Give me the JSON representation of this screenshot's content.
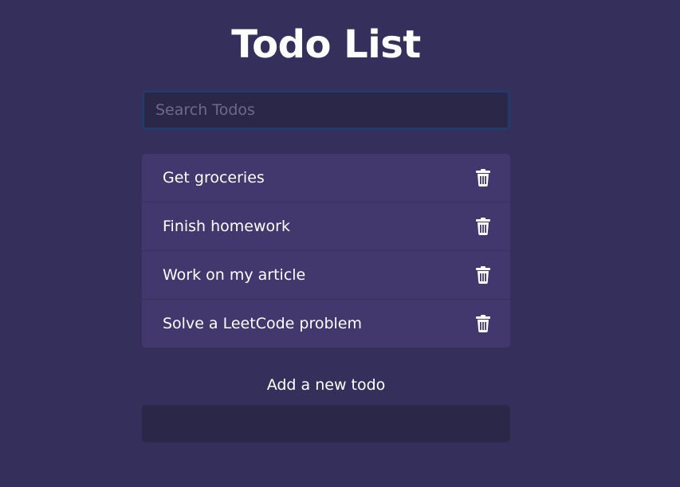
{
  "header": {
    "title": "Todo List"
  },
  "search": {
    "placeholder": "Search Todos",
    "value": ""
  },
  "todos": [
    {
      "label": "Get groceries",
      "icon": "trash-icon"
    },
    {
      "label": "Finish homework",
      "icon": "trash-icon"
    },
    {
      "label": "Work on my article",
      "icon": "trash-icon"
    },
    {
      "label": "Solve a LeetCode problem",
      "icon": "trash-icon"
    }
  ],
  "add_form": {
    "label": "Add a new todo",
    "value": ""
  },
  "colors": {
    "background": "#352f5b",
    "list_item": "#42386d",
    "input_bg": "#2b2748",
    "focus_border": "#233a6a",
    "text": "#ffffff"
  }
}
